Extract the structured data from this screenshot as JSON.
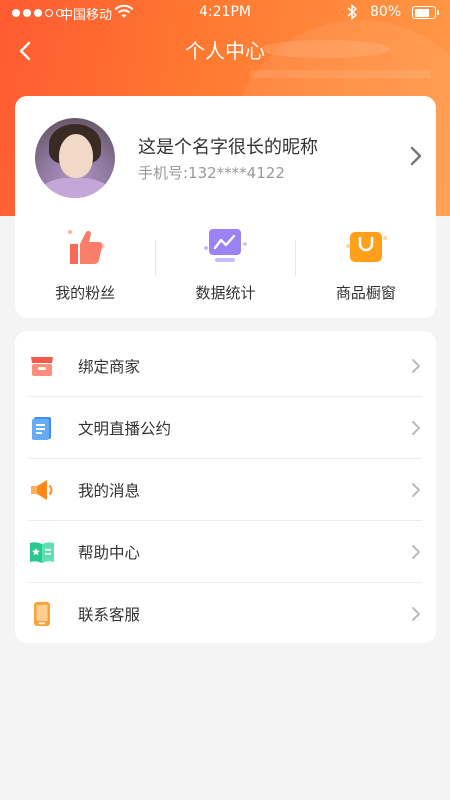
{
  "status_bar": {
    "carrier": "中国移动",
    "time": "4:21PM",
    "battery": "80%",
    "battery_level": 0.8
  },
  "nav": {
    "title": "个人中心"
  },
  "profile": {
    "nickname": "这是个名字很长的昵称",
    "phone": "手机号:132****4122"
  },
  "stats": [
    {
      "label": "我的粉丝",
      "icon": "thumbs-up-icon"
    },
    {
      "label": "数据统计",
      "icon": "chart-icon"
    },
    {
      "label": "商品橱窗",
      "icon": "shopping-bag-icon"
    }
  ],
  "menu": [
    {
      "label": "绑定商家",
      "icon": "store-icon"
    },
    {
      "label": "文明直播公约",
      "icon": "document-icon"
    },
    {
      "label": "我的消息",
      "icon": "megaphone-icon"
    },
    {
      "label": "帮助中心",
      "icon": "help-book-icon"
    },
    {
      "label": "联系客服",
      "icon": "phone-icon"
    }
  ],
  "colors": {
    "header_start": "#ff5a32",
    "header_end": "#ff9a48",
    "background": "#f4f4f4"
  }
}
